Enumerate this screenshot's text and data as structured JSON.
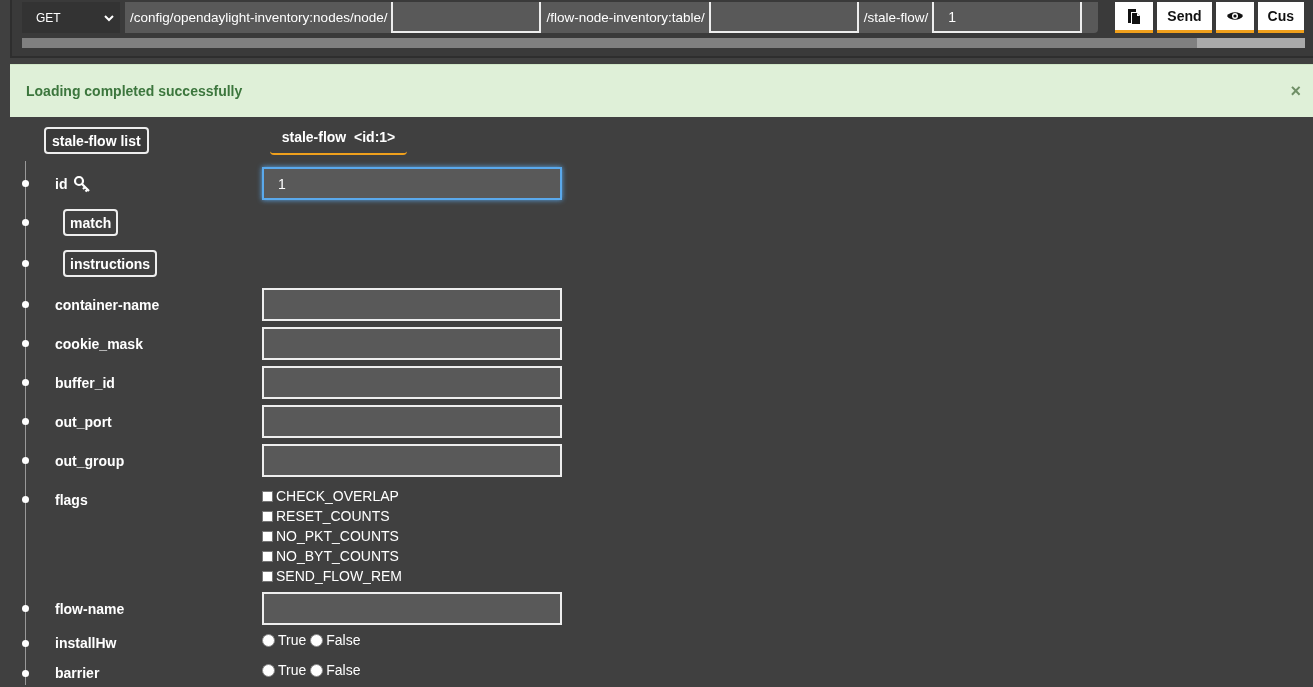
{
  "request_bar": {
    "method": "GET",
    "segments": [
      {
        "kind": "text",
        "text": "/config/opendaylight-inventory:nodes/node/"
      },
      {
        "kind": "input"
      },
      {
        "kind": "text",
        "text": "/flow-node-inventory:table/"
      },
      {
        "kind": "input"
      },
      {
        "kind": "text",
        "text": "/stale-flow/"
      },
      {
        "kind": "input",
        "value": "1"
      }
    ],
    "buttons": [
      {
        "kind": "copy"
      },
      {
        "kind": "text",
        "label": "Send"
      },
      {
        "kind": "preview"
      },
      {
        "kind": "text",
        "label": "Cus"
      }
    ]
  },
  "alert": {
    "message": "Loading completed successfully",
    "close": "×"
  },
  "list_button": "stale-flow list",
  "tabs": [
    {
      "label": "stale-flow  <id:1>",
      "selected": true
    }
  ],
  "fields": [
    {
      "kind": "input",
      "label": "id",
      "key": true,
      "value": "1",
      "focused": true
    },
    {
      "kind": "container",
      "label": "match"
    },
    {
      "kind": "container",
      "label": "instructions"
    },
    {
      "kind": "input",
      "label": "container-name",
      "key": false,
      "focused": false
    },
    {
      "kind": "input",
      "label": "cookie_mask",
      "key": false,
      "focused": false
    },
    {
      "kind": "input",
      "label": "buffer_id",
      "key": false,
      "focused": false
    },
    {
      "kind": "input",
      "label": "out_port",
      "key": false,
      "focused": false
    },
    {
      "kind": "input",
      "label": "out_group",
      "key": false,
      "focused": false
    },
    {
      "kind": "checkboxes",
      "label": "flags",
      "options": [
        {
          "label": "CHECK_OVERLAP",
          "checked": false
        },
        {
          "label": "RESET_COUNTS",
          "checked": false
        },
        {
          "label": "NO_PKT_COUNTS",
          "checked": false
        },
        {
          "label": "NO_BYT_COUNTS",
          "checked": false
        },
        {
          "label": "SEND_FLOW_REM",
          "checked": false
        }
      ]
    },
    {
      "kind": "input",
      "label": "flow-name",
      "key": false,
      "focused": false
    },
    {
      "kind": "radio",
      "label": "installHw",
      "options": [
        {
          "label": "True",
          "selected": false
        },
        {
          "label": "False",
          "selected": false
        }
      ]
    },
    {
      "kind": "radio",
      "label": "barrier",
      "options": [
        {
          "label": "True",
          "selected": false
        },
        {
          "label": "False",
          "selected": false
        }
      ]
    }
  ]
}
